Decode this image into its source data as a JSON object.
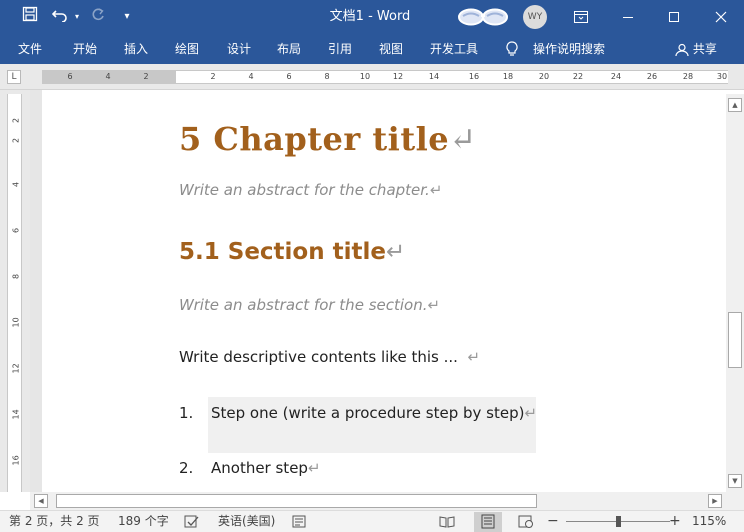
{
  "titlebar": {
    "save_icon": "save-icon",
    "undo_icon": "undo-icon",
    "redo_icon": "redo-icon",
    "customize_icon": "customize-quick-access-icon",
    "title": "文档1 - Word",
    "user_initials": "WY",
    "ribbon_display_icon": "ribbon-display-options-icon",
    "minimize_icon": "minimize-icon",
    "maximize_icon": "maximize-icon",
    "close_icon": "close-icon",
    "color": "#2b579a"
  },
  "ribbon": {
    "tabs": [
      "文件",
      "开始",
      "插入",
      "绘图",
      "设计",
      "布局",
      "引用",
      "视图",
      "开发工具"
    ],
    "tell_me": "操作说明搜索",
    "share": "共享"
  },
  "ruler": {
    "tab_selector": "L",
    "h_numbers_left": [
      "6",
      "4",
      "2"
    ],
    "h_numbers_right": [
      "2",
      "4",
      "6",
      "8",
      "10",
      "12",
      "14",
      "16",
      "18",
      "20",
      "22",
      "24",
      "26",
      "28",
      "30"
    ],
    "v_numbers": [
      "2",
      "2",
      "4",
      "6",
      "8",
      "10",
      "12",
      "14",
      "16"
    ]
  },
  "document": {
    "chapter_title": "5 Chapter title",
    "chapter_abstract": "Write an abstract for the chapter.",
    "section_title": "5.1 Section title",
    "section_abstract": "Write an abstract for the section.",
    "body": "Write descriptive contents like this ...",
    "list": [
      {
        "num": "1.",
        "text": "Step one (write a procedure step by step)"
      },
      {
        "num": "2.",
        "text": "Another step"
      }
    ],
    "pilcrow": "↵",
    "heading_color": "#a2601c",
    "abstract_color": "#8c8c8c"
  },
  "statusbar": {
    "page": "第 2 页，共 2 页",
    "words": "189 个字",
    "language": "英语(美国)",
    "zoom": "115%",
    "zoom_minus": "−",
    "zoom_plus": "+",
    "zoom_level_percent": 115
  }
}
